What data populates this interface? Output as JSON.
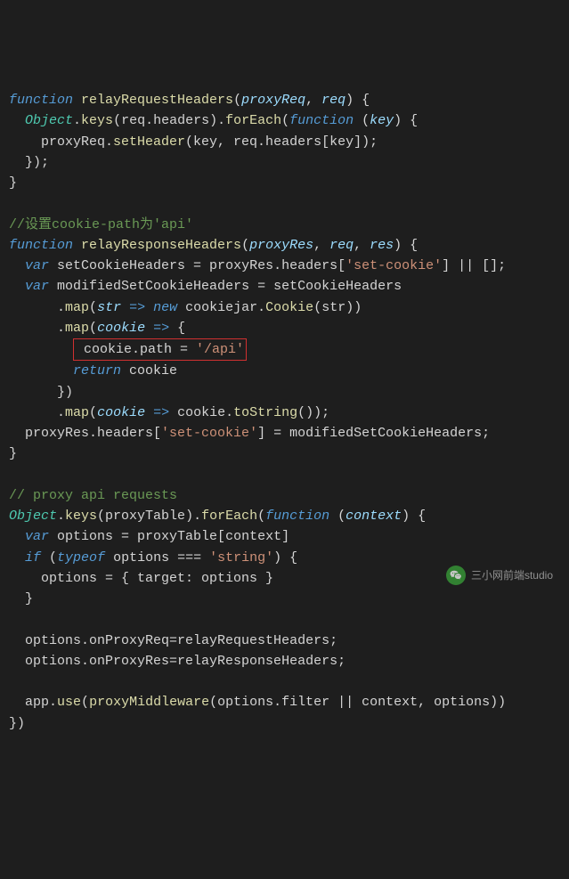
{
  "code": {
    "lines": [
      {
        "indent": 0,
        "segments": [
          {
            "cls": "kw-blue",
            "t": "function"
          },
          {
            "cls": "plain",
            "t": " "
          },
          {
            "cls": "fn-yellow",
            "t": "relayRequestHeaders"
          },
          {
            "cls": "plain",
            "t": "("
          },
          {
            "cls": "param",
            "t": "proxyReq"
          },
          {
            "cls": "plain",
            "t": ", "
          },
          {
            "cls": "param",
            "t": "req"
          },
          {
            "cls": "plain",
            "t": ") {"
          }
        ]
      },
      {
        "indent": 1,
        "segments": [
          {
            "cls": "class-teal",
            "t": "Object"
          },
          {
            "cls": "plain",
            "t": "."
          },
          {
            "cls": "fn-yellow",
            "t": "keys"
          },
          {
            "cls": "plain",
            "t": "(req.headers)."
          },
          {
            "cls": "fn-yellow",
            "t": "forEach"
          },
          {
            "cls": "plain",
            "t": "("
          },
          {
            "cls": "kw-blue",
            "t": "function"
          },
          {
            "cls": "plain",
            "t": " ("
          },
          {
            "cls": "param",
            "t": "key"
          },
          {
            "cls": "plain",
            "t": ") {"
          }
        ]
      },
      {
        "indent": 2,
        "segments": [
          {
            "cls": "plain",
            "t": "proxyReq."
          },
          {
            "cls": "fn-yellow",
            "t": "setHeader"
          },
          {
            "cls": "plain",
            "t": "(key, req.headers[key]);"
          }
        ]
      },
      {
        "indent": 1,
        "segments": [
          {
            "cls": "plain",
            "t": "});"
          }
        ]
      },
      {
        "indent": 0,
        "segments": [
          {
            "cls": "plain",
            "t": "}"
          }
        ]
      },
      {
        "indent": 0,
        "segments": []
      },
      {
        "indent": 0,
        "segments": [
          {
            "cls": "comment",
            "t": "//设置cookie-path为'api'"
          }
        ]
      },
      {
        "indent": 0,
        "segments": [
          {
            "cls": "kw-blue",
            "t": "function"
          },
          {
            "cls": "plain",
            "t": " "
          },
          {
            "cls": "fn-yellow",
            "t": "relayResponseHeaders"
          },
          {
            "cls": "plain",
            "t": "("
          },
          {
            "cls": "param",
            "t": "proxyRes"
          },
          {
            "cls": "plain",
            "t": ", "
          },
          {
            "cls": "param",
            "t": "req"
          },
          {
            "cls": "plain",
            "t": ", "
          },
          {
            "cls": "param",
            "t": "res"
          },
          {
            "cls": "plain",
            "t": ") {"
          }
        ]
      },
      {
        "indent": 1,
        "segments": [
          {
            "cls": "kw-blue",
            "t": "var"
          },
          {
            "cls": "plain",
            "t": " setCookieHeaders = proxyRes.headers["
          },
          {
            "cls": "str",
            "t": "'set-cookie'"
          },
          {
            "cls": "plain",
            "t": "] || [];"
          }
        ]
      },
      {
        "indent": 1,
        "segments": [
          {
            "cls": "kw-blue",
            "t": "var"
          },
          {
            "cls": "plain",
            "t": " modifiedSetCookieHeaders = setCookieHeaders"
          }
        ]
      },
      {
        "indent": 3,
        "segments": [
          {
            "cls": "plain",
            "t": "."
          },
          {
            "cls": "fn-yellow",
            "t": "map"
          },
          {
            "cls": "plain",
            "t": "("
          },
          {
            "cls": "param",
            "t": "str"
          },
          {
            "cls": "plain",
            "t": " "
          },
          {
            "cls": "arrow",
            "t": "=>"
          },
          {
            "cls": "plain",
            "t": " "
          },
          {
            "cls": "kw-blue",
            "t": "new"
          },
          {
            "cls": "plain",
            "t": " cookiejar."
          },
          {
            "cls": "fn-yellow",
            "t": "Cookie"
          },
          {
            "cls": "plain",
            "t": "(str))"
          }
        ]
      },
      {
        "indent": 3,
        "segments": [
          {
            "cls": "plain",
            "t": "."
          },
          {
            "cls": "fn-yellow",
            "t": "map"
          },
          {
            "cls": "plain",
            "t": "("
          },
          {
            "cls": "param",
            "t": "cookie"
          },
          {
            "cls": "plain",
            "t": " "
          },
          {
            "cls": "arrow",
            "t": "=>"
          },
          {
            "cls": "plain",
            "t": " {"
          }
        ]
      },
      {
        "indent": 4,
        "boxed": true,
        "segments": [
          {
            "cls": "plain",
            "t": " cookie.path = "
          },
          {
            "cls": "str",
            "t": "'/api'"
          }
        ]
      },
      {
        "indent": 4,
        "segments": [
          {
            "cls": "kw-blue",
            "t": "return"
          },
          {
            "cls": "plain",
            "t": " cookie"
          }
        ]
      },
      {
        "indent": 3,
        "segments": [
          {
            "cls": "plain",
            "t": "})"
          }
        ]
      },
      {
        "indent": 3,
        "segments": [
          {
            "cls": "plain",
            "t": "."
          },
          {
            "cls": "fn-yellow",
            "t": "map"
          },
          {
            "cls": "plain",
            "t": "("
          },
          {
            "cls": "param",
            "t": "cookie"
          },
          {
            "cls": "plain",
            "t": " "
          },
          {
            "cls": "arrow",
            "t": "=>"
          },
          {
            "cls": "plain",
            "t": " cookie."
          },
          {
            "cls": "fn-yellow",
            "t": "toString"
          },
          {
            "cls": "plain",
            "t": "());"
          }
        ]
      },
      {
        "indent": 1,
        "segments": [
          {
            "cls": "plain",
            "t": "proxyRes.headers["
          },
          {
            "cls": "str",
            "t": "'set-cookie'"
          },
          {
            "cls": "plain",
            "t": "] = modifiedSetCookieHeaders;"
          }
        ]
      },
      {
        "indent": 0,
        "segments": [
          {
            "cls": "plain",
            "t": "}"
          }
        ]
      },
      {
        "indent": 0,
        "segments": []
      },
      {
        "indent": 0,
        "segments": [
          {
            "cls": "comment",
            "t": "// proxy api requests"
          }
        ]
      },
      {
        "indent": 0,
        "segments": [
          {
            "cls": "class-teal",
            "t": "Object"
          },
          {
            "cls": "plain",
            "t": "."
          },
          {
            "cls": "fn-yellow",
            "t": "keys"
          },
          {
            "cls": "plain",
            "t": "(proxyTable)."
          },
          {
            "cls": "fn-yellow",
            "t": "forEach"
          },
          {
            "cls": "plain",
            "t": "("
          },
          {
            "cls": "kw-blue",
            "t": "function"
          },
          {
            "cls": "plain",
            "t": " ("
          },
          {
            "cls": "param",
            "t": "context"
          },
          {
            "cls": "plain",
            "t": ") {"
          }
        ]
      },
      {
        "indent": 1,
        "segments": [
          {
            "cls": "kw-blue",
            "t": "var"
          },
          {
            "cls": "plain",
            "t": " options = proxyTable[context]"
          }
        ]
      },
      {
        "indent": 1,
        "segments": [
          {
            "cls": "kw-blue",
            "t": "if"
          },
          {
            "cls": "plain",
            "t": " ("
          },
          {
            "cls": "kw-blue",
            "t": "typeof"
          },
          {
            "cls": "plain",
            "t": " options === "
          },
          {
            "cls": "str",
            "t": "'string'"
          },
          {
            "cls": "plain",
            "t": ") {"
          }
        ]
      },
      {
        "indent": 2,
        "segments": [
          {
            "cls": "plain",
            "t": "options = { target: options }"
          }
        ]
      },
      {
        "indent": 1,
        "segments": [
          {
            "cls": "plain",
            "t": "}"
          }
        ]
      },
      {
        "indent": 0,
        "segments": []
      },
      {
        "indent": 1,
        "segments": [
          {
            "cls": "plain",
            "t": "options.onProxyReq=relayRequestHeaders;"
          }
        ]
      },
      {
        "indent": 1,
        "segments": [
          {
            "cls": "plain",
            "t": "options.onProxyRes=relayResponseHeaders;"
          }
        ]
      },
      {
        "indent": 0,
        "segments": []
      },
      {
        "indent": 1,
        "segments": [
          {
            "cls": "plain",
            "t": "app."
          },
          {
            "cls": "fn-yellow",
            "t": "use"
          },
          {
            "cls": "plain",
            "t": "("
          },
          {
            "cls": "fn-yellow",
            "t": "proxyMiddleware"
          },
          {
            "cls": "plain",
            "t": "(options.filter || context, options))"
          }
        ]
      },
      {
        "indent": 0,
        "segments": [
          {
            "cls": "plain",
            "t": "})"
          }
        ]
      }
    ]
  },
  "watermark": {
    "text": "三小网前端studio"
  }
}
